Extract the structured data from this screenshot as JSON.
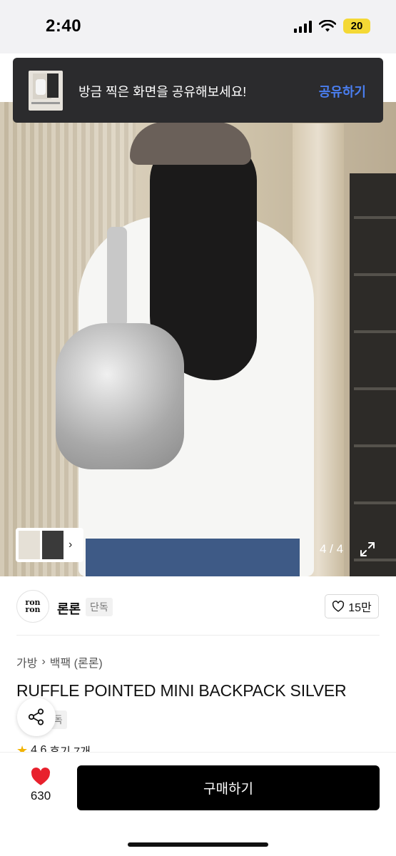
{
  "status_bar": {
    "time": "2:40",
    "battery": "20"
  },
  "toast": {
    "message": "방금 찍은 화면을 공유해보세요!",
    "action": "공유하기"
  },
  "gallery": {
    "page_indicator": "4 / 4",
    "thumbnails_chevron": "›"
  },
  "brand": {
    "logo_line1": "ron",
    "logo_line2": "ron",
    "name": "론론",
    "badge": "단독"
  },
  "like": {
    "count": "15만"
  },
  "breadcrumb": {
    "category": "가방",
    "separator": "›",
    "subcategory": "백팩 (론론)"
  },
  "product": {
    "title": "RUFFLE POINTED MINI BACKPACK SILVER",
    "badge": "단독",
    "rating": "4.6",
    "reviews": "후기 7개"
  },
  "bottom_bar": {
    "wish_count": "630",
    "buy_label": "구매하기"
  },
  "colors": {
    "accent_blue": "#4a7ef0",
    "heart_red": "#e8212d",
    "battery_yellow": "#f4d835"
  }
}
